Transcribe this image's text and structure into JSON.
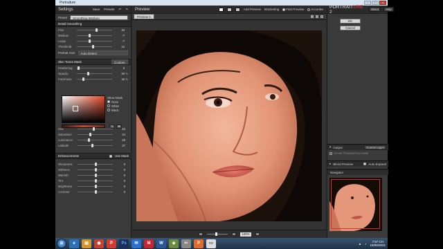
{
  "window": {
    "title": "Portraiture"
  },
  "settings": {
    "title": "Settings",
    "save_label": "Save",
    "presets_label": "Presets",
    "preset_label": "Preset",
    "preset_value": "Smoothing Medium"
  },
  "detail_smoothing": {
    "title": "Detail Smoothing",
    "sliders": [
      {
        "label": "Fine",
        "value": "10",
        "level": 0.55
      },
      {
        "label": "Medium",
        "value": "-7",
        "level": 0.35
      },
      {
        "label": "Large",
        "value": "-7",
        "level": 0.35
      },
      {
        "label": "Threshold",
        "value": "12",
        "level": 0.45
      }
    ],
    "portrait_size_label": "Portrait Size",
    "portrait_size_value": "Auto Detect"
  },
  "skin_tones_mask": {
    "title": "Skin Tones Mask",
    "mode": "Custom",
    "sliders": [
      {
        "label": "Feathering",
        "value": "0",
        "level": 0.02
      },
      {
        "label": "Opacity",
        "value": "30",
        "unit": "%",
        "level": 0.3
      },
      {
        "label": "Fuzziness",
        "value": "16",
        "unit": "%",
        "level": 0.16
      }
    ],
    "show_mask_label": "Show Mask",
    "show_mask_options": [
      "None",
      "White",
      "Black"
    ],
    "show_mask_selected": "None",
    "color_sliders": [
      {
        "label": "Hue",
        "value": "63",
        "level": 0.45
      },
      {
        "label": "Saturation",
        "value": "34",
        "level": 0.35
      },
      {
        "label": "Luminance",
        "value": "25",
        "level": 0.3
      },
      {
        "label": "Latitude",
        "value": "37",
        "level": 0.4
      }
    ]
  },
  "enhancements": {
    "title": "Enhancements",
    "use_mask_label": "Use Mask",
    "sliders": [
      {
        "label": "Sharpness",
        "value": "0",
        "level": 0.5
      },
      {
        "label": "Softness",
        "value": "0",
        "level": 0.5
      },
      {
        "label": "Warmth",
        "value": "0",
        "level": 0.5
      },
      {
        "label": "Tint",
        "value": "0",
        "level": 0.5
      },
      {
        "label": "Brightness",
        "value": "0",
        "level": 0.5
      },
      {
        "label": "Contrast",
        "value": "0",
        "level": 0.5
      }
    ]
  },
  "preview": {
    "title": "Preview",
    "add_preview_label": "Add Preview",
    "bracketing_label": "Bracketing",
    "fast_preview_label": "Fast Preview",
    "accurate_label": "Accurate",
    "tab_label": "Preview 1",
    "zoom_value": "100%"
  },
  "right_panel": {
    "brand_prefix": "PORTRAIT",
    "brand_suffix": "URE",
    "brand_version": "2",
    "about_label": "About",
    "help_label": "Help",
    "ok_label": "OK",
    "cancel_label": "Cancel",
    "output_title": "Output",
    "output_value": "Current Layer",
    "create_transparency_label": "Create Transparency Mask",
    "blend_preview_label": "Blend Preview",
    "auto_expand_label": "Auto Expand",
    "navigator_title": "Navigator"
  },
  "taskbar": {
    "time": "7:57 CH",
    "date": "15/06/2021"
  },
  "colors": {
    "panel": "#3a3a3a",
    "accent_red": "#cc3333",
    "taskbar": "#2a4560"
  }
}
